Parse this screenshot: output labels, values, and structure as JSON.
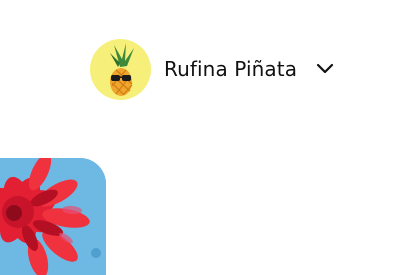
{
  "account": {
    "user_name": "Rufina Piñata",
    "avatar_icon": "pineapple-with-sunglasses",
    "dropdown_icon": "chevron-down-icon"
  },
  "hero": {
    "image": "red-dahlia-flower-on-blue"
  },
  "colors": {
    "avatar_bg": "#f6f07a",
    "card_bg": "#6eb8e4",
    "flower_red": "#d9142a"
  }
}
